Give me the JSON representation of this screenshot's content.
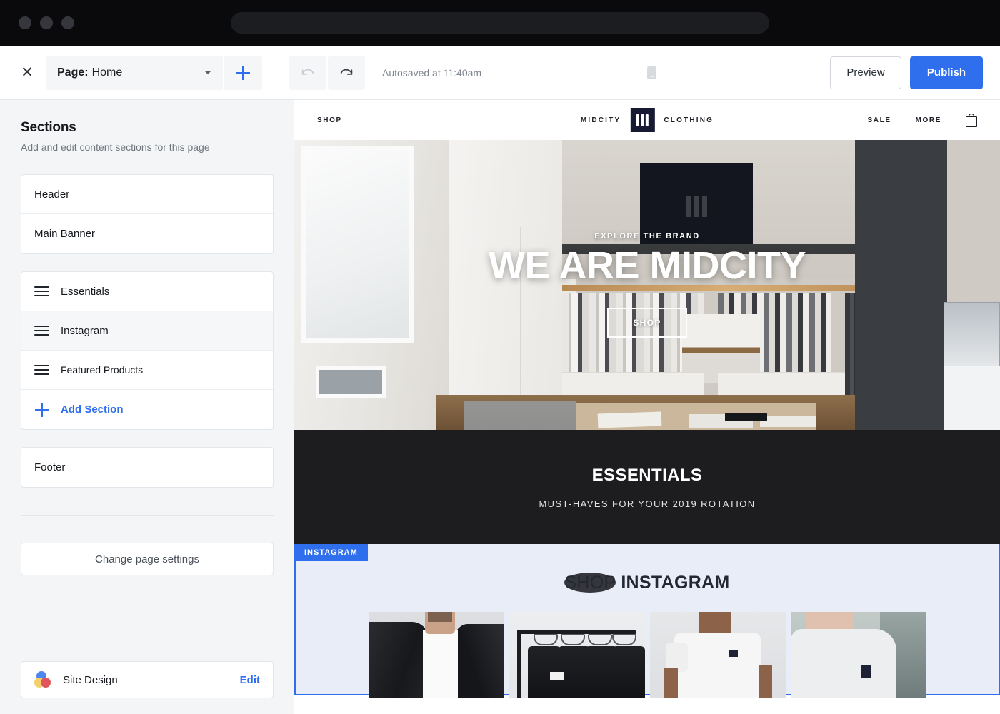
{
  "browser": {
    "traffic_lights": [
      "close",
      "minimize",
      "maximize"
    ],
    "address_value": ""
  },
  "toolbar": {
    "close_label": "✕",
    "page_label": "Page:",
    "page_value": "Home",
    "add_page_icon": "plus-icon",
    "undo_icon": "undo-arrow-icon",
    "redo_icon": "redo-arrow-icon",
    "autosave_text": "Autosaved at 11:40am",
    "device_desktop_icon": "monitor-icon",
    "device_mobile_icon": "phone-icon",
    "device_active": "desktop",
    "preview_label": "Preview",
    "publish_label": "Publish",
    "accent_color": "#2f6fed"
  },
  "sidebar": {
    "title": "Sections",
    "subtitle": "Add and edit content sections for this page",
    "fixed_top": [
      {
        "label": "Header"
      },
      {
        "label": "Main Banner"
      }
    ],
    "draggable": [
      {
        "label": "Essentials",
        "active": false
      },
      {
        "label": "Instagram",
        "active": true
      },
      {
        "label": "Featured Products",
        "active": false
      }
    ],
    "add_section_label": "Add Section",
    "fixed_bottom": [
      {
        "label": "Footer"
      }
    ],
    "page_settings_label": "Change page settings",
    "site_design": {
      "icon": "color-palette-icon",
      "label": "Site Design",
      "edit_label": "Edit"
    }
  },
  "preview": {
    "site_header": {
      "left_nav": [
        "SHOP"
      ],
      "brand_left": "MIDCITY",
      "brand_logo_icon": "midcity-m-logo",
      "brand_right": "CLOTHING",
      "right_nav": [
        "SALE",
        "MORE"
      ],
      "cart_icon": "shopping-bag-icon"
    },
    "hero": {
      "kicker": "EXPLORE THE BRAND",
      "title": "WE ARE MIDCITY",
      "button_label": "SHOP"
    },
    "essentials": {
      "title": "ESSENTIALS",
      "subtitle": "MUST-HAVES FOR YOUR 2019 ROTATION",
      "background_color": "#1d1d1f"
    },
    "instagram": {
      "badge_label": "INSTAGRAM",
      "title_light": "SHOP",
      "title_bold": "INSTAGRAM",
      "highlight_color": "#2f6fed",
      "background_color": "#e9edf7",
      "tiles": [
        {
          "alt": "man in black leather jacket over white tee"
        },
        {
          "alt": "black shirts on a clothing rack"
        },
        {
          "alt": "man in white t-shirt with logo patch"
        },
        {
          "alt": "grey sweatshirt with navy logo patch"
        }
      ]
    }
  }
}
